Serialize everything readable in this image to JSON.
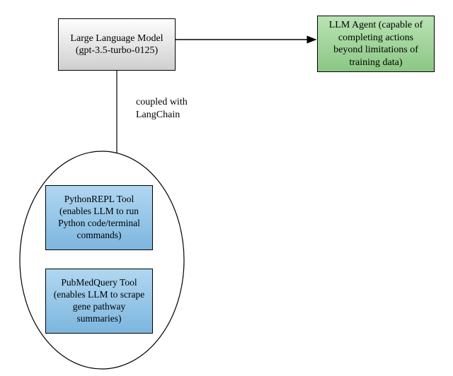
{
  "nodes": {
    "llm": {
      "line1": "Large Language Model",
      "line2": "(gpt-3.5-turbo-0125)"
    },
    "agent": {
      "line1": "LLM Agent (capable of",
      "line2": "completing actions",
      "line3": "beyond limitations of",
      "line4": "training data)"
    },
    "tool_python": {
      "line1": "PythonREPL Tool",
      "line2": "(enables LLM to run",
      "line3": "Python code/terminal",
      "line4": "commands)"
    },
    "tool_pubmed": {
      "line1": "PubMedQuery Tool",
      "line2": "(enables LLM to scrape",
      "line3": "gene pathway",
      "line4": "summaries)"
    }
  },
  "edges": {
    "couple": {
      "line1": "coupled with",
      "line2": "LangChain"
    }
  }
}
